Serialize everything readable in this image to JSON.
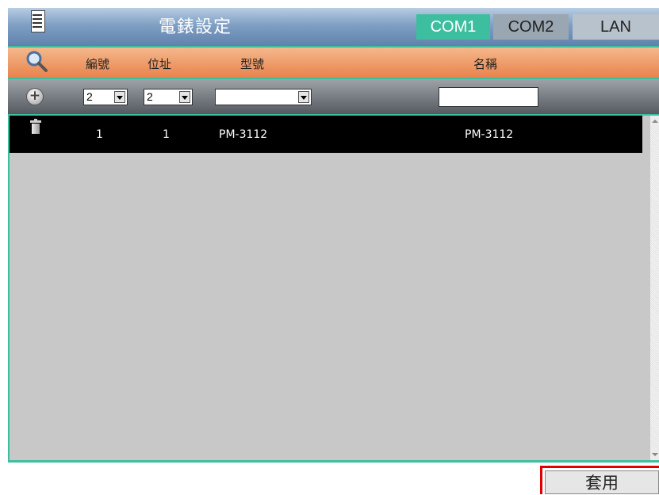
{
  "header": {
    "title": "電錶設定",
    "tabs": [
      {
        "label": "COM1",
        "active": true
      },
      {
        "label": "COM2",
        "active": false
      },
      {
        "label": "LAN",
        "active": false
      }
    ]
  },
  "columns": {
    "number": "編號",
    "address": "位址",
    "model": "型號",
    "name": "名稱"
  },
  "filter": {
    "number_value": "2",
    "address_value": "2",
    "model_value": "",
    "name_value": ""
  },
  "rows": [
    {
      "number": "1",
      "address": "1",
      "model": "PM-3112",
      "name": "PM-3112"
    }
  ],
  "apply_label": "套用",
  "icons": {
    "menu": "menu-list-icon",
    "search": "search-icon",
    "add": "add-circle-icon",
    "delete": "trash-icon"
  },
  "colors": {
    "accent": "#3dbf9f",
    "header_orange": "#e8834d",
    "highlight_red": "#e00000"
  }
}
